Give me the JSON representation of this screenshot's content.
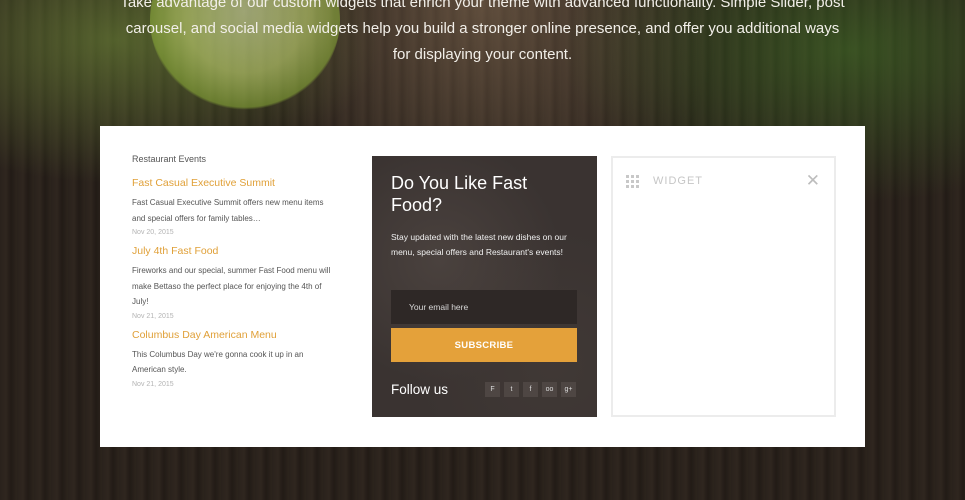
{
  "hero": {
    "line1": "Take advantage of our custom widgets that enrich your theme with advanced functionality. Simple Slider, post",
    "line2": "carousel, and social media widgets help you build a stronger online presence, and offer you additional ways",
    "line3": "for displaying your content."
  },
  "events": {
    "title": "Restaurant Events",
    "items": [
      {
        "title": "Fast Casual Executive Summit",
        "desc": "Fast Casual Executive Summit offers new menu items and special offers for family tables…",
        "date": "Nov 20, 2015"
      },
      {
        "title": "July 4th Fast Food",
        "desc": "Fireworks and our special, summer Fast Food menu will make Bettaso the perfect place for enjoying the 4th of July!",
        "date": "Nov 21, 2015"
      },
      {
        "title": "Columbus Day American Menu",
        "desc": "This Columbus Day we're gonna cook it up in an American style.",
        "date": "Nov 21, 2015"
      }
    ]
  },
  "subscribe": {
    "heading": "Do You Like Fast Food?",
    "text": "Stay updated with the latest new dishes on our menu, special offers and Restaurant's events!",
    "placeholder": "Your email here",
    "button": "SUBSCRIBE",
    "follow": "Follow us",
    "socials": [
      {
        "name": "foursquare-icon",
        "glyph": "F"
      },
      {
        "name": "twitter-icon",
        "glyph": "t"
      },
      {
        "name": "facebook-icon",
        "glyph": "f"
      },
      {
        "name": "tripadvisor-icon",
        "glyph": "oo"
      },
      {
        "name": "google-plus-icon",
        "glyph": "g+"
      }
    ]
  },
  "widget": {
    "label": "WIDGET",
    "close": "✕"
  },
  "colors": {
    "accent": "#e4a13a",
    "dark_panel": "#3a3331"
  }
}
